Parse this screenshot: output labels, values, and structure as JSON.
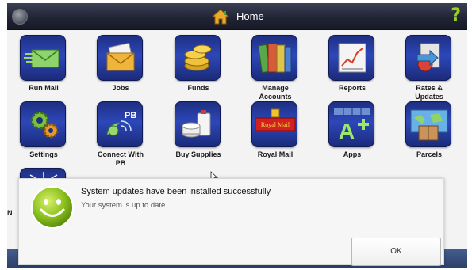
{
  "header": {
    "title": "Home",
    "help_glyph": "?",
    "back_icon": "back-circle-icon",
    "home_icon": "home-icon",
    "accent": "#9ad11e"
  },
  "apps": [
    {
      "label": "Run Mail",
      "icon": "run-mail-icon"
    },
    {
      "label": "Jobs",
      "icon": "envelope-icon"
    },
    {
      "label": "Funds",
      "icon": "coins-icon"
    },
    {
      "label": "Manage\nAccounts",
      "icon": "books-icon"
    },
    {
      "label": "Reports",
      "icon": "chart-icon"
    },
    {
      "label": "Rates &\nUpdates",
      "icon": "rates-icon"
    },
    {
      "label": "Settings",
      "icon": "gears-icon"
    },
    {
      "label": "Connect With\nPB",
      "icon": "satellite-icon"
    },
    {
      "label": "Buy Supplies",
      "icon": "supplies-icon"
    },
    {
      "label": "Royal Mail",
      "icon": "royal-mail-icon"
    },
    {
      "label": "Apps",
      "icon": "apps-plus-icon"
    },
    {
      "label": "Parcels",
      "icon": "parcel-map-icon"
    },
    {
      "label": "N",
      "icon": "starburst-icon"
    }
  ],
  "dialog": {
    "title": "System updates have been installed successfully",
    "message": "Your system is up to date.",
    "ok_label": "OK",
    "icon": "smiley-icon"
  },
  "tile_texts": {
    "pb": "PB",
    "royal_mail": "Royal Mail"
  }
}
